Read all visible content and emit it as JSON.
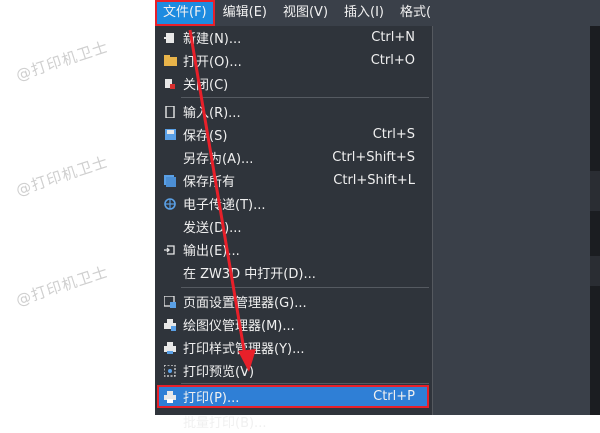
{
  "menubar": {
    "items": [
      "文件(F)",
      "编辑(E)",
      "视图(V)",
      "插入(I)",
      "格式("
    ],
    "active": "文件(F)"
  },
  "file_menu": {
    "items": [
      {
        "label": "新建(N)...",
        "shortcut": "Ctrl+N",
        "icon": "new-file-icon"
      },
      {
        "label": "打开(O)...",
        "shortcut": "Ctrl+O",
        "icon": "folder-icon"
      },
      {
        "label": "关闭(C)",
        "shortcut": "",
        "icon": "close-document-icon"
      },
      {
        "label": "输入(R)...",
        "shortcut": "",
        "icon": "import-icon"
      },
      {
        "label": "保存(S)",
        "shortcut": "Ctrl+S",
        "icon": "save-icon"
      },
      {
        "label": "另存为(A)...",
        "shortcut": "Ctrl+Shift+S",
        "icon": ""
      },
      {
        "label": "保存所有",
        "shortcut": "Ctrl+Shift+L",
        "icon": "save-all-icon"
      },
      {
        "label": "电子传递(T)...",
        "shortcut": "",
        "icon": "globe-icon"
      },
      {
        "label": "发送(D)...",
        "shortcut": "",
        "icon": ""
      },
      {
        "label": "输出(E)...",
        "shortcut": "",
        "icon": "export-icon"
      },
      {
        "label": "在 ZW3D 中打开(D)...",
        "shortcut": "",
        "icon": ""
      },
      {
        "label": "页面设置管理器(G)...",
        "shortcut": "",
        "icon": "page-setup-icon"
      },
      {
        "label": "绘图仪管理器(M)...",
        "shortcut": "",
        "icon": "plotter-icon"
      },
      {
        "label": "打印样式管理器(Y)...",
        "shortcut": "",
        "icon": "plot-style-icon"
      },
      {
        "label": "打印预览(V)",
        "shortcut": "",
        "icon": "print-preview-icon"
      },
      {
        "label": "打印(P)...",
        "shortcut": "Ctrl+P",
        "icon": "printer-icon"
      },
      {
        "label": "批量打印(B)...",
        "shortcut": "",
        "icon": ""
      }
    ],
    "highlighted": "打印(P)..."
  },
  "watermark": "@打印机卫士",
  "colors": {
    "menu_bg": "#2f343b",
    "highlight": "#2f7fd6",
    "annotation": "#e8202a"
  }
}
